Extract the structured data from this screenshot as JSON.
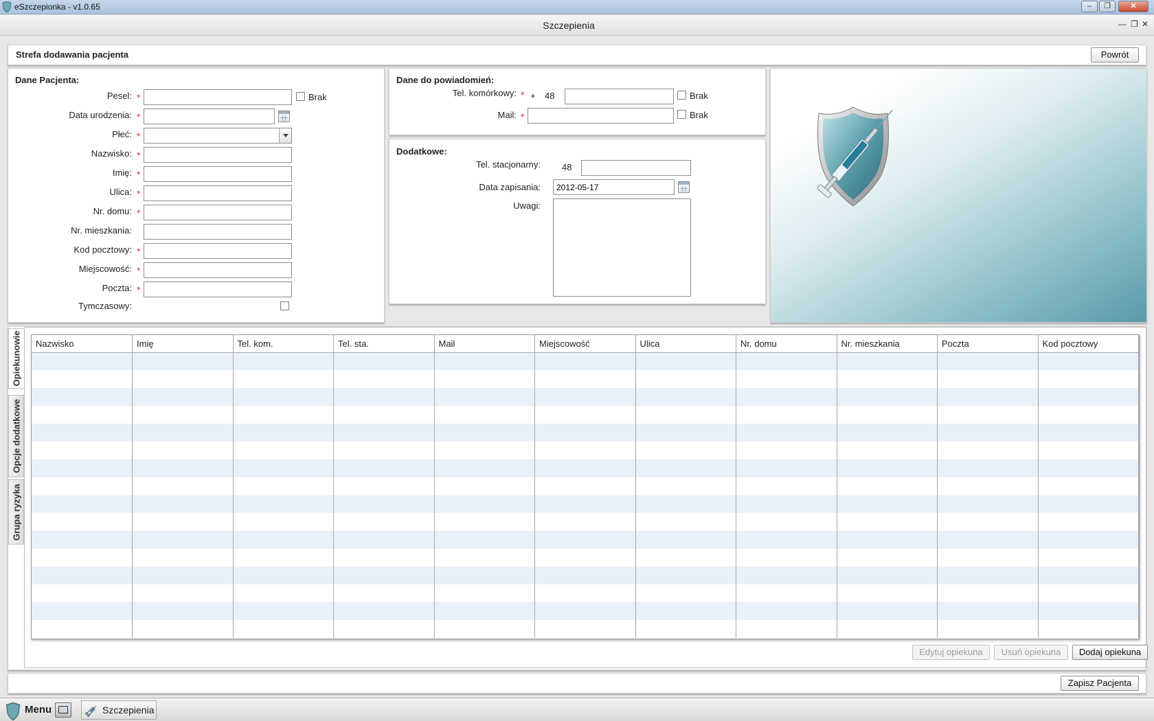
{
  "os_window": {
    "title": "eSzczepionka - v1.0.65",
    "minimize": "–",
    "maximize": "❐",
    "close": "✕"
  },
  "inner_window": {
    "title": "Szczepienia",
    "minimize": "—",
    "restore": "❐",
    "close": "✕"
  },
  "header": {
    "label": "Strefa dodawania pacjenta",
    "back_button": "Powrót"
  },
  "patient_data": {
    "section_title": "Dane Pacjenta:",
    "fields": [
      {
        "label": "Pesel:",
        "required": "*",
        "value": "",
        "checkbox": "Brak"
      },
      {
        "label": "Data urodzenia:",
        "required": "*",
        "value": ""
      },
      {
        "label": "Płeć:",
        "required": "*",
        "value": ""
      },
      {
        "label": "Nazwisko:",
        "required": "*",
        "value": ""
      },
      {
        "label": "Imię:",
        "required": "*",
        "value": ""
      },
      {
        "label": "Ulica:",
        "required": "*",
        "value": ""
      },
      {
        "label": "Nr. domu:",
        "required": "*",
        "value": ""
      },
      {
        "label": "Nr. mieszkania:",
        "required": "",
        "value": ""
      },
      {
        "label": "Kod pocztowy:",
        "required": "*",
        "value": ""
      },
      {
        "label": "Miejscowość:",
        "required": "*",
        "value": ""
      },
      {
        "label": "Poczta:",
        "required": "*",
        "value": ""
      },
      {
        "label": "Tymczasowy:",
        "required": "",
        "value": ""
      }
    ]
  },
  "notifications": {
    "section_title": "Dane do powiadomień:",
    "mobile_label": "Tel. komórkowy:",
    "mobile_required": "*",
    "mobile_plus": "+",
    "mobile_prefix": "48",
    "mobile_value": "",
    "mobile_checkbox": "Brak",
    "mail_label": "Mail:",
    "mail_required": "*",
    "mail_value": "",
    "mail_checkbox": "Brak"
  },
  "additional": {
    "section_title": "Dodatkowe:",
    "landline_label": "Tel. stacjonarny:",
    "landline_prefix": "48",
    "landline_value": "",
    "signup_date_label": "Data zapisania:",
    "signup_date_value": "2012-05-17",
    "notes_label": "Uwagi:",
    "notes_value": ""
  },
  "side_tabs": [
    {
      "label": "Opiekunowie",
      "active": true
    },
    {
      "label": "Opcje dodatkowe",
      "active": false
    },
    {
      "label": "Grupa ryzyka",
      "active": false
    }
  ],
  "guardians_table": {
    "columns": [
      "Nazwisko",
      "Imię",
      "Tel. kom.",
      "Tel. sta.",
      "Mail",
      "Miejscowość",
      "Ulica",
      "Nr. domu",
      "Nr. mieszkania",
      "Poczta",
      "Kod pocztowy"
    ],
    "rows": []
  },
  "guardian_buttons": {
    "edit": "Edytuj opiekuna",
    "remove": "Usuń opiekuna",
    "add": "Dodaj opiekuna"
  },
  "save_button": "Zapisz Pacjenta",
  "taskbar": {
    "menu_label": "Menu",
    "task_label": "Szczepienia"
  },
  "colors": {
    "required": "#d23b3b",
    "row_stripe": "#eaf0f7",
    "image_gradient_end": "#5a9aa8"
  }
}
